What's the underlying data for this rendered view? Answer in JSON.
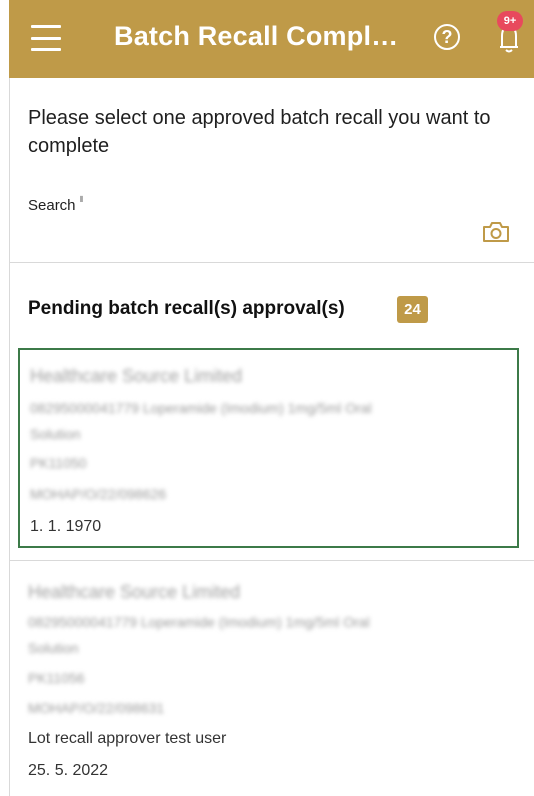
{
  "header": {
    "title": "Batch Recall Compl…",
    "help_icon": "help-circle-icon",
    "notification_badge": "9+",
    "background": "#bf9a48"
  },
  "prompt": "Please select one approved batch recall you want to complete",
  "search": {
    "label": "Search",
    "barcode_icon_glyph": "⦀",
    "camera_icon": "camera-icon"
  },
  "pending": {
    "title": "Pending batch recall(s) approval(s)",
    "count": "24"
  },
  "items": [
    {
      "company": "Healthcare Source Limited",
      "product_line1": "08295000041779 Loperamide (Imodium) 1mg/5ml Oral",
      "product_line2": "Solution",
      "batch": "PK11050",
      "reference": "MOHAP/O/22/098626",
      "user": "",
      "date": "1. 1. 1970",
      "selected": true
    },
    {
      "company": "Healthcare Source Limited",
      "product_line1": "08295000041779 Loperamide (Imodium) 1mg/5ml Oral",
      "product_line2": "Solution",
      "batch": "PK11056",
      "reference": "MOHAP/O/22/098631",
      "user": "Lot recall approver test user",
      "date": "25. 5. 2022",
      "selected": false
    }
  ]
}
